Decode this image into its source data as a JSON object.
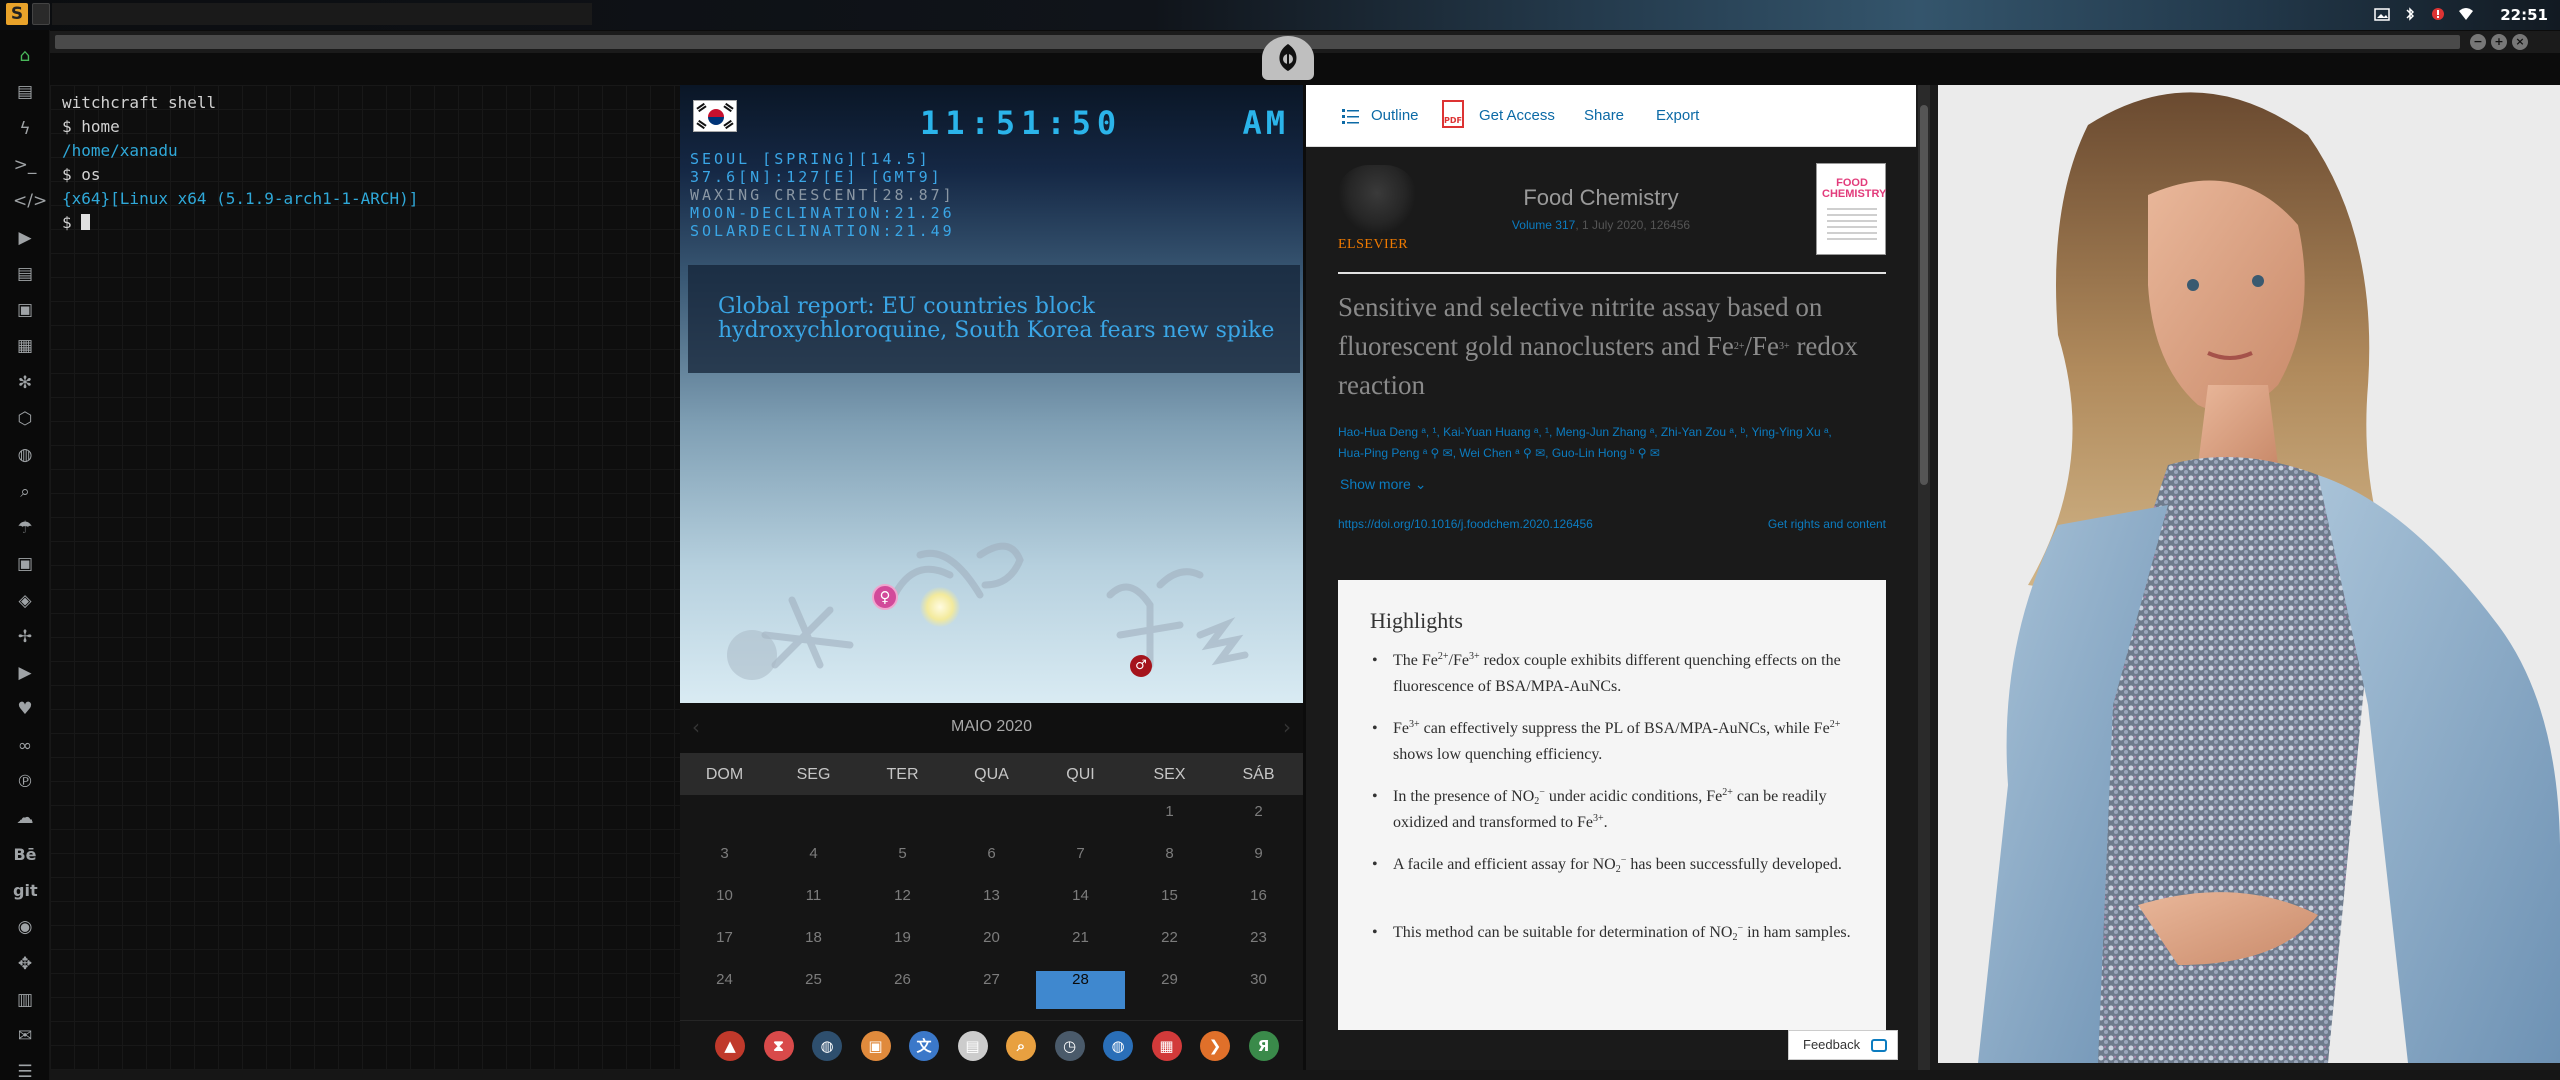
{
  "topbar": {
    "clock": "22:51",
    "tray_icons": [
      "image-icon",
      "bluetooth-icon",
      "alert-icon",
      "wifi-icon"
    ]
  },
  "window_controls": [
    "minimize-icon",
    "maximize-icon",
    "close-icon"
  ],
  "dock": {
    "items": [
      {
        "name": "home-icon",
        "glyph": "⌂",
        "active": true
      },
      {
        "name": "file-icon",
        "glyph": "▤"
      },
      {
        "name": "bolt-icon",
        "glyph": "ϟ"
      },
      {
        "name": "terminal-icon",
        "glyph": ">_"
      },
      {
        "name": "code-icon",
        "glyph": "</>"
      },
      {
        "name": "play-icon",
        "glyph": "▶"
      },
      {
        "name": "document-icon",
        "glyph": "▤"
      },
      {
        "name": "image-icon",
        "glyph": "▣"
      },
      {
        "name": "news-icon",
        "glyph": "▦"
      },
      {
        "name": "settings-icon",
        "glyph": "✻"
      },
      {
        "name": "hexagon-icon",
        "glyph": "⬡"
      },
      {
        "name": "globe-icon",
        "glyph": "◍"
      },
      {
        "name": "search-icon",
        "glyph": "⌕"
      },
      {
        "name": "umbrella-icon",
        "glyph": "☂"
      },
      {
        "name": "contact-icon",
        "glyph": "▣"
      },
      {
        "name": "git-diamond-icon",
        "glyph": "◈"
      },
      {
        "name": "expand-icon",
        "glyph": "✢"
      },
      {
        "name": "youtube-icon",
        "glyph": "▶"
      },
      {
        "name": "heart-icon",
        "glyph": "♥"
      },
      {
        "name": "infinity-icon",
        "glyph": "∞"
      },
      {
        "name": "pinterest-icon",
        "glyph": "℗"
      },
      {
        "name": "cloud-icon",
        "glyph": "☁"
      },
      {
        "name": "behance-icon",
        "glyph": "Bē",
        "text": true
      },
      {
        "name": "git-icon",
        "glyph": "git",
        "text": true
      },
      {
        "name": "github-icon",
        "glyph": "◉"
      },
      {
        "name": "gamepad-icon",
        "glyph": "✥"
      },
      {
        "name": "map-icon",
        "glyph": "▥"
      },
      {
        "name": "mail-icon",
        "glyph": "✉"
      },
      {
        "name": "storage-icon",
        "glyph": "☰"
      }
    ]
  },
  "terminal": {
    "lines": [
      {
        "text": "witchcraft shell",
        "style": "w"
      },
      {
        "text": "$ home",
        "style": "w"
      },
      {
        "text": "/home/xanadu",
        "style": "c"
      },
      {
        "text": "$ os",
        "style": "w"
      },
      {
        "text": "{x64}[Linux x64 (5.1.9-arch1-1-ARCH)]",
        "style": "c"
      },
      {
        "text": "$ ",
        "style": "w",
        "cursor": true
      }
    ]
  },
  "widget": {
    "time": "11:51:50",
    "ampm": "AM",
    "info_lines": [
      {
        "text": "SEOUL [SPRING][14.5]",
        "color": "#3aa6e6"
      },
      {
        "text": "37.6[N]:127[E] [GMT9]",
        "color": "#3aa6e6"
      },
      {
        "text": "WAXING CRESCENT[28.87]",
        "color": "#8a97a4"
      },
      {
        "text": "MOON-DECLINATION:21.26",
        "color": "#3aa6e6"
      },
      {
        "text": "SOLARDECLINATION:21.49",
        "color": "#3aa6e6"
      }
    ],
    "news": "Global report: EU countries block hydroxychloroquine, South Korea fears new spike",
    "venus_symbol": "♀",
    "mars_symbol": "♂"
  },
  "calendar": {
    "month": "MAIO 2020",
    "weekdays": [
      "DOM",
      "SEG",
      "TER",
      "QUA",
      "QUI",
      "SEX",
      "SÁB"
    ],
    "weeks": [
      [
        "",
        "",
        "",
        "",
        "",
        "1",
        "2"
      ],
      [
        "3",
        "4",
        "5",
        "6",
        "7",
        "8",
        "9"
      ],
      [
        "10",
        "11",
        "12",
        "13",
        "14",
        "15",
        "16"
      ],
      [
        "17",
        "18",
        "19",
        "20",
        "21",
        "22",
        "23"
      ],
      [
        "24",
        "25",
        "26",
        "27",
        "28",
        "29",
        "30"
      ]
    ],
    "today": "28",
    "prev": "‹",
    "next": "›"
  },
  "launcher": {
    "apps": [
      {
        "name": "arch-icon",
        "color": "#c0392b",
        "glyph": "▲"
      },
      {
        "name": "hourglass-icon",
        "color": "#d94a4a",
        "glyph": "⧗"
      },
      {
        "name": "earth-icon",
        "color": "#2e4f6e",
        "glyph": "◍"
      },
      {
        "name": "photo-icon",
        "color": "#e08a3c",
        "glyph": "▣"
      },
      {
        "name": "translate-icon",
        "color": "#3b78c9",
        "glyph": "文"
      },
      {
        "name": "notes-icon",
        "color": "#cccccc",
        "glyph": "▤"
      },
      {
        "name": "magnifier-icon",
        "color": "#e8a040",
        "glyph": "⌕"
      },
      {
        "name": "clock-icon",
        "color": "#4a5a6a",
        "glyph": "◷"
      },
      {
        "name": "web-icon",
        "color": "#2a6fb8",
        "glyph": "◍"
      },
      {
        "name": "calendar-icon",
        "color": "#d23a3a",
        "glyph": "▦"
      },
      {
        "name": "arrow-icon",
        "color": "#e0702a",
        "glyph": "❯"
      },
      {
        "name": "yandex-icon",
        "color": "#3a8a4a",
        "glyph": "Я"
      }
    ]
  },
  "article": {
    "toolbar": {
      "outline": "Outline",
      "get_access": "Get Access",
      "share": "Share",
      "export": "Export"
    },
    "publisher": "ELSEVIER",
    "journal": "Food Chemistry",
    "volume": "Volume 317",
    "date_page": ", 1 July 2020, 126456",
    "cover_title": "FOOD CHEMISTRY",
    "title_part1": "Sensitive and selective nitrite assay based on fluorescent gold nanoclusters and Fe",
    "title_sup1": "2+",
    "title_mid": "/Fe",
    "title_sup2": "3+",
    "title_end": " redox reaction",
    "authors_line1": "Hao-Hua Deng ᵃ, ¹, Kai-Yuan Huang ᵃ, ¹, Meng-Jun Zhang ᵃ, Zhi-Yan Zou ᵃ, ᵇ, Ying-Ying Xu ᵃ,",
    "authors_line2": "Hua-Ping Peng ᵃ ⚲ ✉, Wei Chen ᵃ ⚲ ✉, Guo-Lin Hong ᵇ ⚲ ✉",
    "show_more": "Show more",
    "doi": "https://doi.org/10.1016/j.foodchem.2020.126456",
    "rights": "Get rights and content",
    "highlights_title": "Highlights",
    "highlights": [
      {
        "parts": [
          "The Fe",
          "2+",
          "/Fe",
          "3+",
          " redox couple exhibits different quenching effects on the fluorescence of BSA/MPA-AuNCs."
        ]
      },
      {
        "parts": [
          "Fe",
          "3+",
          " can effectively suppress the PL of BSA/MPA-AuNCs, while Fe",
          "2+",
          " shows low quenching efficiency."
        ]
      },
      {
        "parts": [
          "In the presence of NO",
          "2",
          "−",
          " under acidic conditions, Fe",
          "2+",
          " can be readily oxidized and transformed to Fe",
          "3+",
          "."
        ]
      },
      {
        "parts": [
          "A facile and efficient assay for NO",
          "2",
          "−",
          " has been successfully developed."
        ]
      },
      {
        "parts": [
          "This method can be suitable for determination of NO",
          "2",
          "−",
          " in ham samples."
        ]
      }
    ],
    "feedback": "Feedback"
  },
  "colors": {
    "accent_cyan": "#2bb4ea",
    "calendar_today": "#3f88cf",
    "elsevier_orange": "#f07a00",
    "link_blue": "#0c7cc0"
  }
}
